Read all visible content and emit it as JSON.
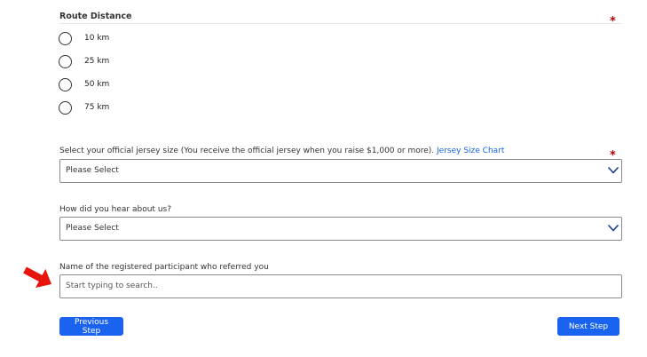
{
  "route": {
    "title": "Route Distance",
    "required_mark": "*",
    "options": [
      {
        "label": "10 km",
        "selected": false
      },
      {
        "label": "25 km",
        "selected": false
      },
      {
        "label": "50 km",
        "selected": false
      },
      {
        "label": "75 km",
        "selected": false
      }
    ]
  },
  "jersey": {
    "label": "Select your official jersey size (You receive the official jersey when you raise $1,000 or more).",
    "link": "Jersey Size Chart",
    "required_mark": "*",
    "value": "Please Select"
  },
  "hear": {
    "label": "How did you hear about us?",
    "value": "Please Select"
  },
  "referrer": {
    "label": "Name of the registered participant who referred you",
    "placeholder": "Start typing to search.."
  },
  "buttons": {
    "previous": "Previous Step",
    "next": "Next Step"
  },
  "colors": {
    "accent": "#1a63f0",
    "required": "#b30000",
    "annotation_arrow": "#e8140c"
  }
}
